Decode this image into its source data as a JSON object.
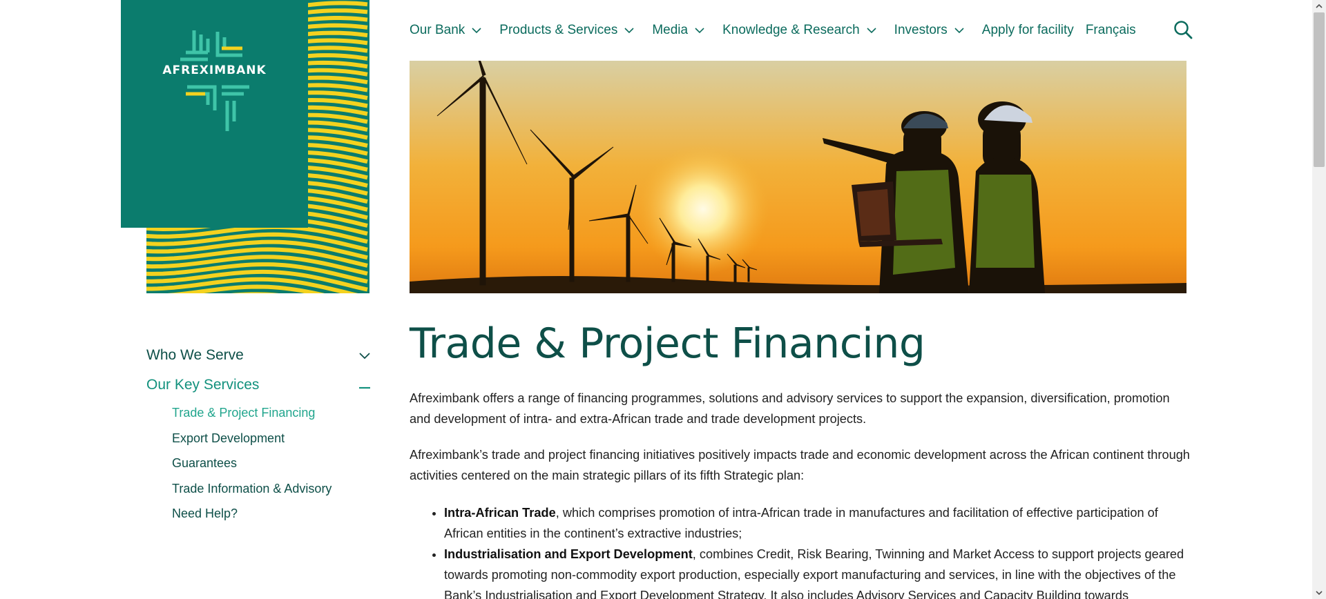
{
  "logo": {
    "text": "AFREXIMBANK"
  },
  "colors": {
    "brand_green": "#0b7c6d",
    "brand_yellow": "#f4d21f",
    "heading_green": "#0e4f48",
    "accent_green": "#21a58d"
  },
  "nav": {
    "items": [
      {
        "label": "Our Bank",
        "has_dropdown": true
      },
      {
        "label": "Products & Services",
        "has_dropdown": true
      },
      {
        "label": "Media",
        "has_dropdown": true
      },
      {
        "label": "Knowledge & Research",
        "has_dropdown": true
      },
      {
        "label": "Investors",
        "has_dropdown": true
      },
      {
        "label": "Apply for facility",
        "has_dropdown": false
      },
      {
        "label": "Français",
        "has_dropdown": false
      }
    ],
    "search_icon": "search-icon"
  },
  "sidebar": {
    "who_we_serve": "Who We Serve",
    "our_key_services": "Our Key Services",
    "sub_items": [
      {
        "label": "Trade & Project Financing",
        "active": true
      },
      {
        "label": "Export Development",
        "active": false
      },
      {
        "label": "Guarantees",
        "active": false
      },
      {
        "label": "Trade Information & Advisory",
        "active": false
      },
      {
        "label": "Need Help?",
        "active": false
      }
    ]
  },
  "main": {
    "title": "Trade & Project Financing",
    "paragraph_1": "Afreximbank offers a range of financing programmes, solutions and advisory services to support the expansion, diversification, promotion and development of intra- and extra-African trade and trade development projects.",
    "paragraph_2": "Afreximbank’s trade and project financing initiatives positively impacts trade and economic development across the African continent through activities centered on the main strategic pillars of its fifth Strategic plan:",
    "bullets": [
      {
        "bold": "Intra-African Trade",
        "text": ", which comprises promotion of intra-African trade in manufactures and facilitation of effective participation of African entities in the continent’s extractive industries;"
      },
      {
        "bold": "Industrialisation and Export Development",
        "text": ", combines Credit, Risk Bearing, Twinning and Market Access to support projects geared towards promoting non-commodity export production, especially export manufacturing and services, in line with the objectives of the Bank’s Industrialisation and Export Development Strategy. It also includes Advisory Services and Capacity Building towards establishing"
      }
    ]
  }
}
